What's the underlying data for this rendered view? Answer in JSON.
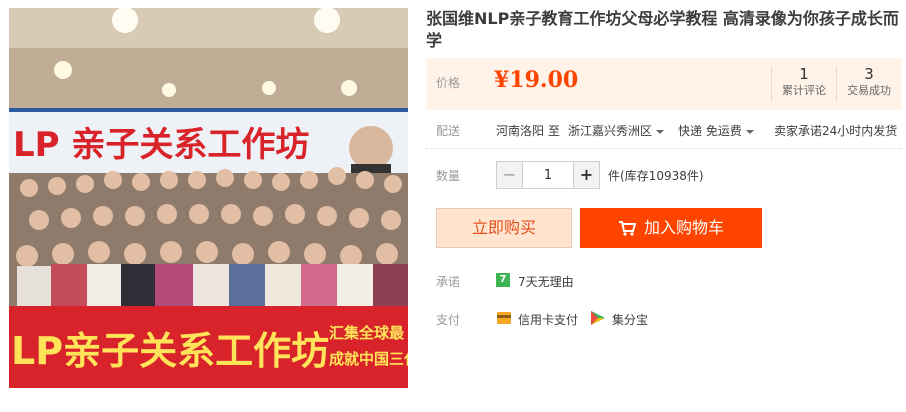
{
  "product": {
    "title": "张国维NLP亲子教育工作坊父母必学教程 高清录像为你孩子成长而学",
    "photo": {
      "banner_top": "LP 亲子关系工作坊",
      "banner_bottom": "LP亲子关系工作坊",
      "banner_side_1": "汇集全球最",
      "banner_side_2": "成就中国三代"
    }
  },
  "price": {
    "label": "价格",
    "value": "¥19.00",
    "comments_count": "1",
    "comments_label": "累计评论",
    "deals_count": "3",
    "deals_label": "交易成功"
  },
  "delivery": {
    "label": "配送",
    "from": "河南洛阳",
    "to_word": "至",
    "to": "浙江嘉兴秀洲区",
    "shipping": "快递 免运费",
    "promise": "卖家承诺24小时内发货"
  },
  "quantity": {
    "label": "数量",
    "minus": "−",
    "value": "1",
    "plus": "+",
    "stock": "件(库存10938件)"
  },
  "actions": {
    "buy_now": "立即购买",
    "add_to_cart": "加入购物车"
  },
  "promise": {
    "label": "承诺",
    "badge": "7",
    "text": "7天无理由"
  },
  "payment": {
    "label": "支付",
    "credit": "信用卡支付",
    "jifen": "集分宝"
  },
  "colors": {
    "accent": "#ff4400",
    "price": "#ff4400",
    "price_bg": "#fff2e8",
    "banner_red": "#d8232a"
  },
  "icons": [
    "cart-icon",
    "credit-card-icon",
    "jifenbao-icon",
    "seven-day-icon",
    "caret-down-icon"
  ]
}
